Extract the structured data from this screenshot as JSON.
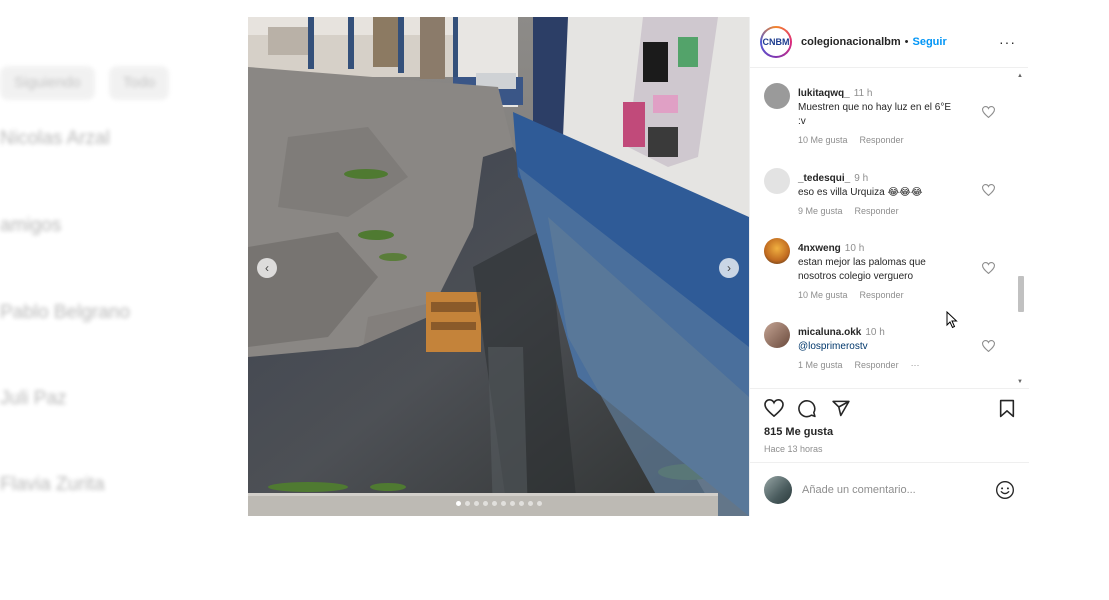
{
  "post": {
    "username": "colegionacionalbm",
    "separator": "•",
    "follow_label": "Seguir",
    "avatar_text": "CNBM",
    "likes": "815 Me gusta",
    "time_ago": "Hace 13 horas"
  },
  "comments": [
    {
      "user": "lukitaqwq_",
      "time": "11 h",
      "text_lines": [
        "Muestren que no hay luz en el 6°E",
        ":v"
      ],
      "likes": "10 Me gusta",
      "reply": "Responder",
      "avatar_color": "#9a9a9a"
    },
    {
      "user": "_tedesqui_",
      "time": "9 h",
      "text_lines": [
        "eso es villa Urquiza 😂😂😂"
      ],
      "likes": "9 Me gusta",
      "reply": "Responder",
      "avatar_color": "#e3e3e3"
    },
    {
      "user": "4nxweng",
      "time": "10 h",
      "text_lines": [
        "estan mejor las palomas que",
        "nosotros colegio verguero"
      ],
      "likes": "10 Me gusta",
      "reply": "Responder",
      "avatar_color": "#d38a2a"
    },
    {
      "user": "micaluna.okk",
      "time": "10 h",
      "text_lines": [
        "@losprimerostv"
      ],
      "likes": "1 Me gusta",
      "reply": "Responder",
      "more": "···",
      "avatar_color": "#8a6a5c"
    }
  ],
  "header_more": "···",
  "comment_box": {
    "placeholder": "Añade un comentario..."
  },
  "carousel": {
    "prev": "‹",
    "next": "›",
    "slide_count": 10,
    "active_slide": 1
  },
  "background": {
    "tabs": [
      "Siguiendo",
      "Todo"
    ],
    "names": [
      "Nicolas Arzal",
      "amigos",
      "Pablo Belgrano",
      "Juli Paz",
      "Flavia Zurita"
    ]
  },
  "colors": {
    "follow_blue": "#0095f6",
    "mention_blue": "#00376b",
    "meta_gray": "#8e8e8e",
    "text": "#262626"
  }
}
